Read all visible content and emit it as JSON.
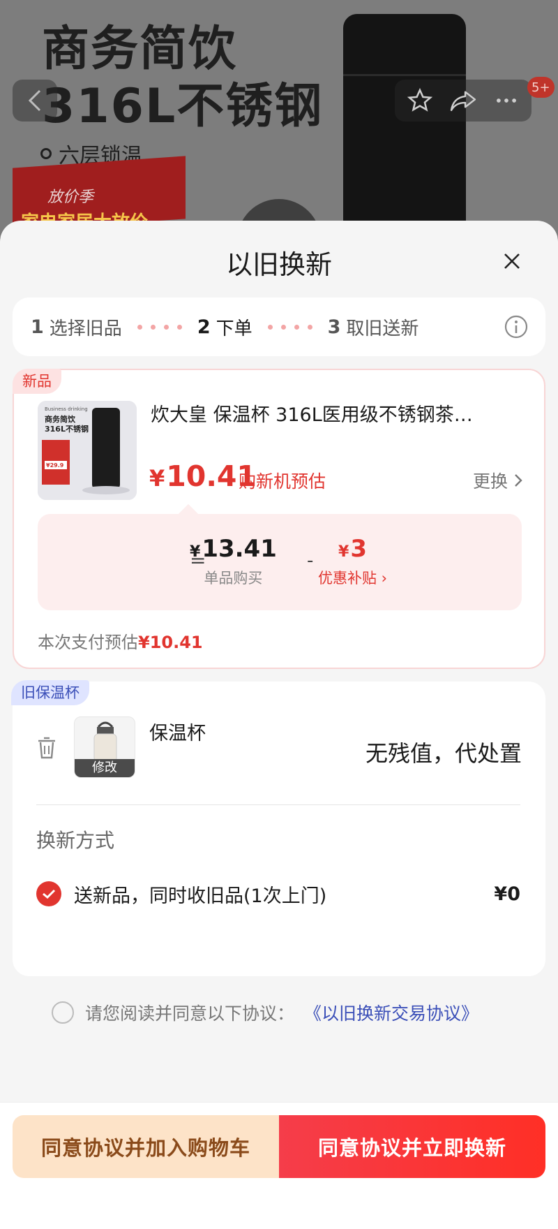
{
  "background_page": {
    "headline_line1": "商务简饮",
    "headline_line2": "316L不锈钢",
    "feature": "六层锁温",
    "promo_line1": "放价季",
    "promo_line2": "家电家居大放价",
    "notification_count": "5+"
  },
  "sheet": {
    "title": "以旧换新"
  },
  "steps": [
    {
      "num": "1",
      "label": "选择旧品"
    },
    {
      "num": "2",
      "label": "下单"
    },
    {
      "num": "3",
      "label": "取旧送新"
    }
  ],
  "new_item": {
    "tag": "新品",
    "image_text_top": "Business drinking",
    "image_text_title1": "商务简饮",
    "image_text_title2": "316L不锈钢",
    "image_price": "¥29.9",
    "name": "炊大皇 保温杯 316L医用级不锈钢茶…",
    "price_symbol": "¥",
    "price": "10.41",
    "price_note": "购新机预估",
    "change_label": "更换",
    "breakdown": {
      "equals": "=",
      "unit_price_symbol": "¥",
      "unit_price": "13.41",
      "unit_price_label": "单品购买",
      "minus": "-",
      "subsidy_symbol": "¥",
      "subsidy": "3",
      "subsidy_label": "优惠补贴 ›"
    },
    "pay_label": "本次支付预估",
    "pay_amount": "¥10.41"
  },
  "old_item": {
    "tag": "旧保温杯",
    "edit_label": "修改",
    "name": "保温杯",
    "value_text": "无残值，代处置",
    "method_title": "换新方式",
    "method_option": "送新品，同时收旧品(1次上门)",
    "method_price": "¥0"
  },
  "agreement": {
    "text": "请您阅读并同意以下协议：",
    "link": "《以旧换新交易协议》"
  },
  "buttons": {
    "add_to_cart": "同意协议并加入购物车",
    "trade_now": "同意协议并立即换新"
  },
  "colors": {
    "accent_red": "#e1352f",
    "link_blue": "#3b4fb8",
    "cart_button_bg": "#fde3c8"
  }
}
